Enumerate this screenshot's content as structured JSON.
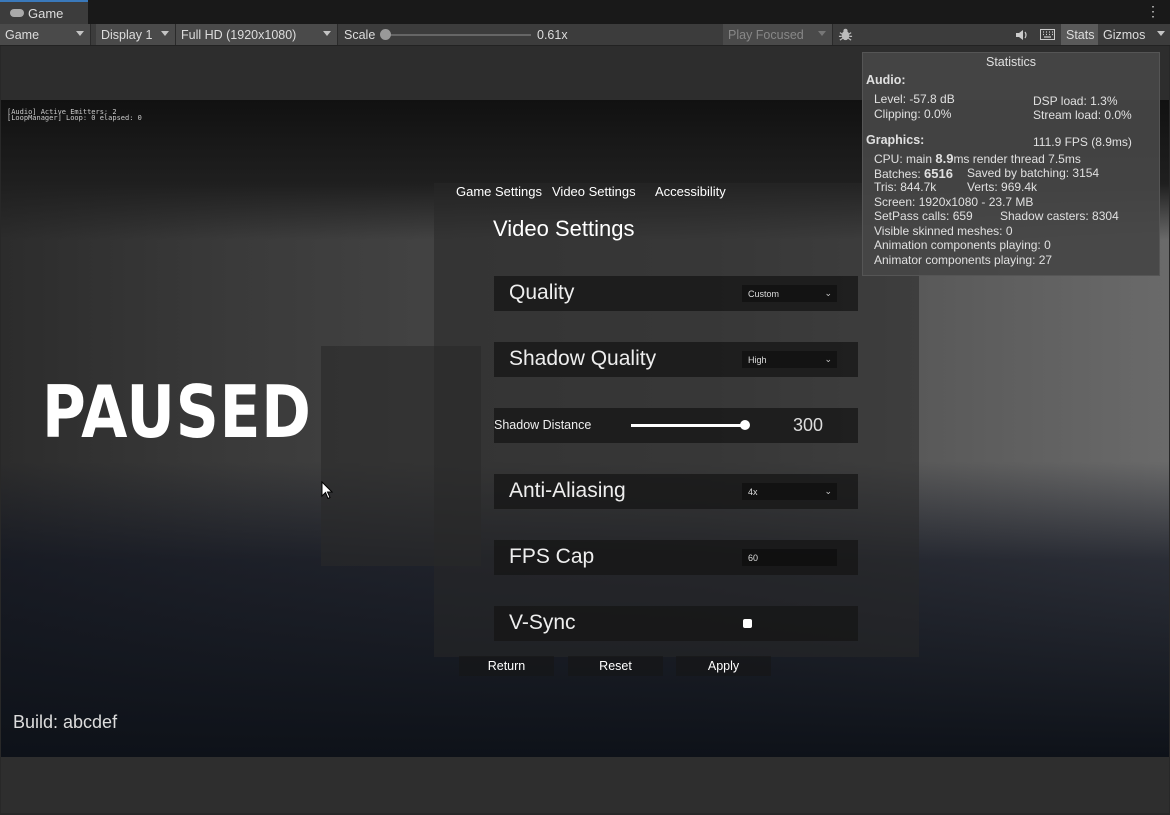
{
  "tab": {
    "label": "Game"
  },
  "toolbar": {
    "view_mode": "Game",
    "display": "Display 1",
    "resolution": "Full HD (1920x1080)",
    "scale_label": "Scale",
    "scale_value": "0.61x",
    "play_mode": "Play Focused",
    "stats_label": "Stats",
    "gizmos_label": "Gizmos"
  },
  "overlay": {
    "line1": "[Audio] Active Emitters: 2",
    "line2": "[LoopManager] Loop: 0 elapsed: 0"
  },
  "paused_text": "PAUSED",
  "build_text": "Build: abcdef",
  "nav": {
    "game": "Game Settings",
    "video": "Video Settings",
    "accessibility": "Accessibility"
  },
  "video": {
    "title": "Video Settings",
    "quality": {
      "label": "Quality",
      "value": "Custom"
    },
    "shadow_quality": {
      "label": "Shadow Quality",
      "value": "High"
    },
    "shadow_distance": {
      "label": "Shadow Distance",
      "value": "300",
      "fraction": 1.0
    },
    "anti_aliasing": {
      "label": "Anti-Aliasing",
      "value": "4x"
    },
    "fps_cap": {
      "label": "FPS Cap",
      "value": "60"
    },
    "vsync": {
      "label": "V-Sync",
      "checked": true
    }
  },
  "actions": {
    "return": "Return",
    "reset": "Reset",
    "apply": "Apply"
  },
  "stats": {
    "title": "Statistics",
    "audio_header": "Audio:",
    "level": "Level: -57.8 dB",
    "dsp": "DSP load: 1.3%",
    "clipping": "Clipping: 0.0%",
    "stream": "Stream load: 0.0%",
    "graphics_header": "Graphics:",
    "fps": "111.9 FPS (8.9ms)",
    "cpu_prefix": "CPU: main ",
    "cpu_main": "8.9",
    "cpu_suffix": "ms  render thread 7.5ms",
    "batches_prefix": "Batches: ",
    "batches": "6516",
    "saved": "Saved by batching: 3154",
    "tris": "Tris: 844.7k",
    "verts": "Verts: 969.4k",
    "screen": "Screen: 1920x1080 - 23.7 MB",
    "setpass": "SetPass calls: 659",
    "shadow_casters": "Shadow casters: 8304",
    "skinned": "Visible skinned meshes: 0",
    "animation": "Animation components playing: 0",
    "animator": "Animator components playing: 27"
  }
}
